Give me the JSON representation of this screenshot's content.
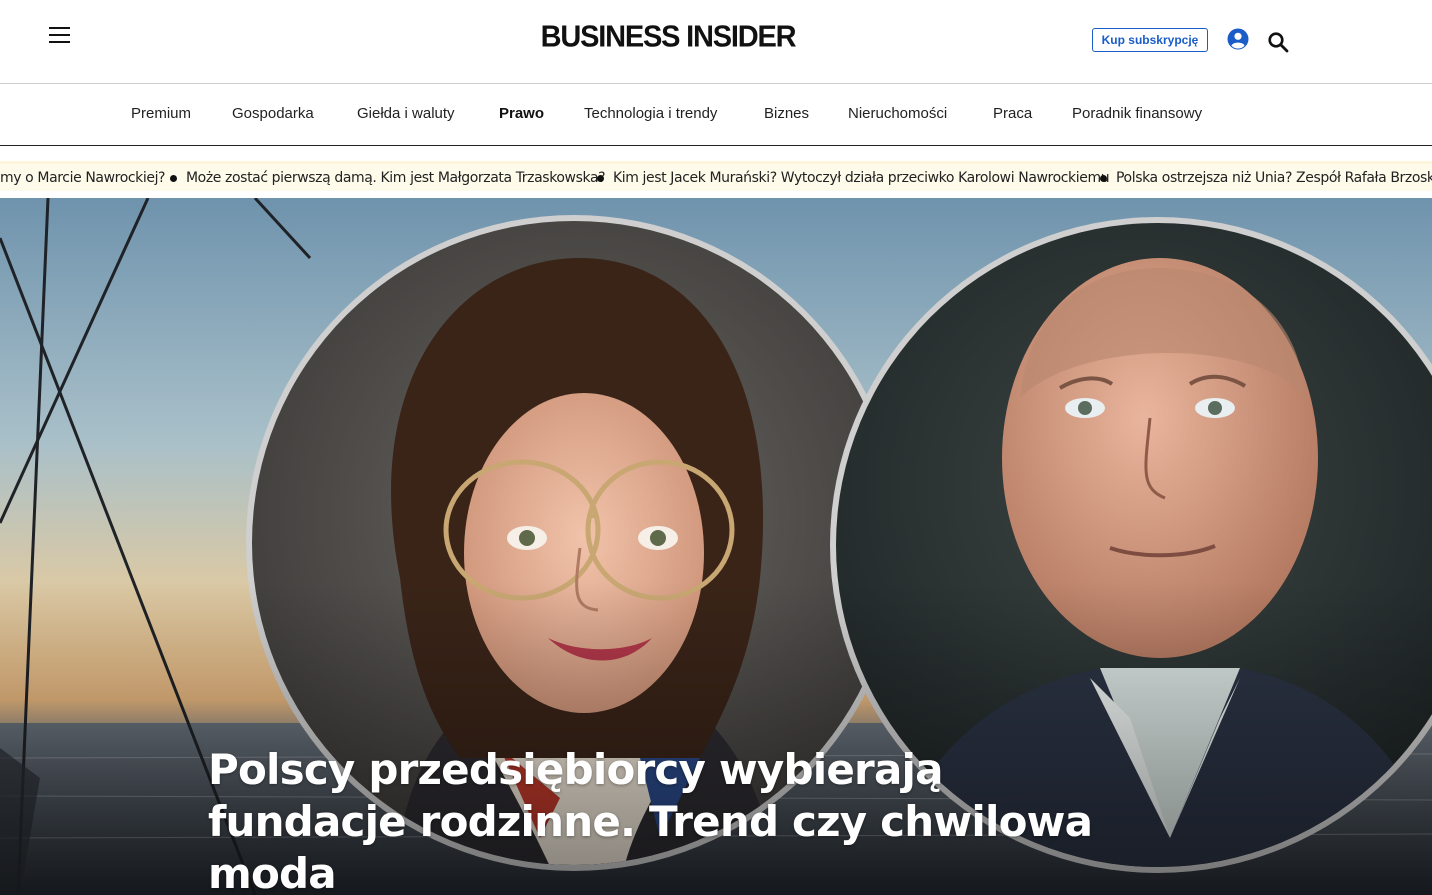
{
  "header": {
    "logo_text": "BUSINESS INSIDER",
    "subscribe_label": "Kup subskrypcję",
    "menu_icon": "hamburger-icon",
    "account_icon": "user-circle-icon",
    "search_icon": "search-icon",
    "accent_color": "#1a5dc8"
  },
  "nav": {
    "items": [
      {
        "label": "Premium"
      },
      {
        "label": "Gospodarka"
      },
      {
        "label": "Giełda i waluty"
      },
      {
        "label": "Prawo",
        "active": true
      },
      {
        "label": "Technologia i trendy"
      },
      {
        "label": "Biznes"
      },
      {
        "label": "Nieruchomości"
      },
      {
        "label": "Praca"
      },
      {
        "label": "Poradnik finansowy"
      }
    ]
  },
  "ticker": {
    "items": [
      {
        "label": "my o Marcie Nawrockiej?"
      },
      {
        "label": "Może zostać pierwszą damą. Kim jest Małgorzata Trzaskowska?"
      },
      {
        "label": "Kim jest Jacek Murański? Wytoczył działa przeciwko Karolowi Nawrockiemu"
      },
      {
        "label": "Polska ostrzejsza niż Unia? Zespół Rafała Brzoski n"
      }
    ]
  },
  "hero": {
    "title_lines": [
      "Polscy przedsiębiorcy wybierają",
      "fundacje rodzinne. Trend czy chwilowa",
      "moda"
    ]
  }
}
